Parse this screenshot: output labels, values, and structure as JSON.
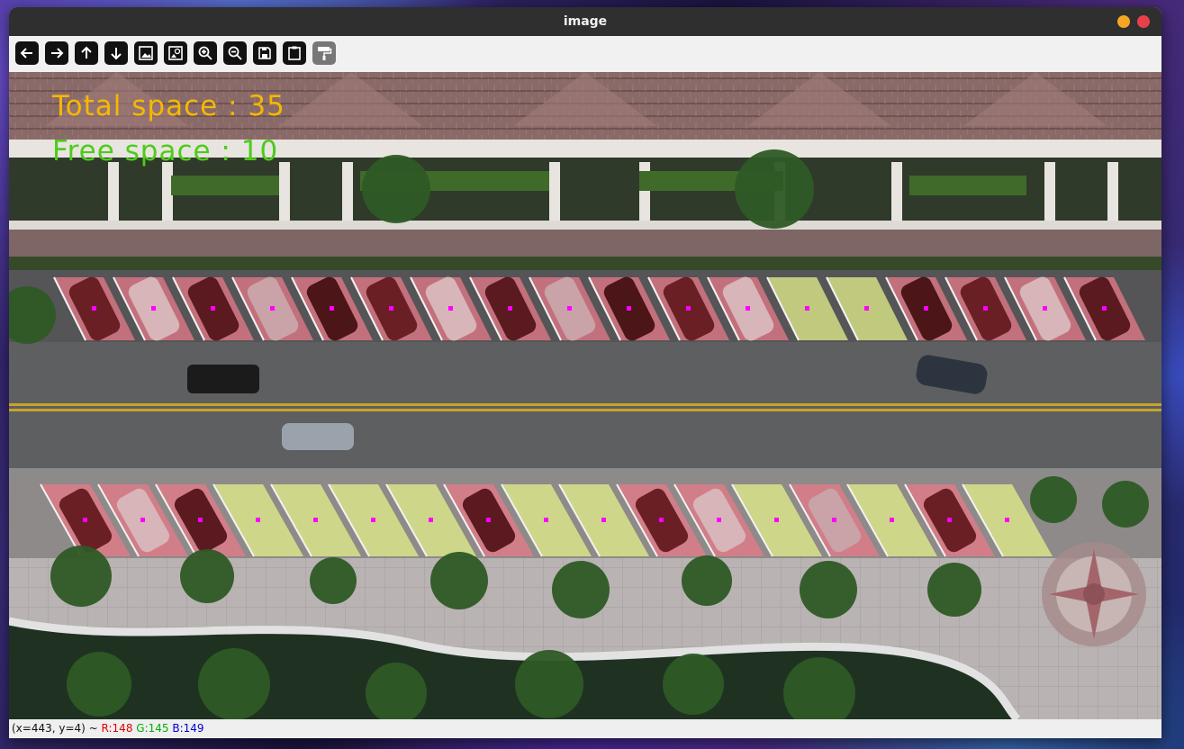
{
  "window": {
    "title": "image"
  },
  "toolbar": {
    "buttons": [
      {
        "name": "pan-left",
        "icon": "arrow-left-icon"
      },
      {
        "name": "pan-right",
        "icon": "arrow-right-icon"
      },
      {
        "name": "pan-up",
        "icon": "arrow-up-icon"
      },
      {
        "name": "pan-down",
        "icon": "arrow-down-icon"
      },
      {
        "name": "zoom-fit",
        "icon": "image-icon"
      },
      {
        "name": "zoom-original",
        "icon": "image-zoom-icon"
      },
      {
        "name": "zoom-in",
        "icon": "zoom-in-icon"
      },
      {
        "name": "zoom-out",
        "icon": "zoom-out-icon"
      },
      {
        "name": "save",
        "icon": "save-icon"
      },
      {
        "name": "copy-clipboard",
        "icon": "clipboard-icon"
      },
      {
        "name": "properties",
        "icon": "paint-roller-icon",
        "disabled": true
      }
    ]
  },
  "overlay": {
    "total_label": "Total space : 35",
    "free_label": "Free space : 10",
    "total_color": "#f5b800",
    "free_color": "#4ccc1a"
  },
  "parking": {
    "top_row_states": [
      "occ",
      "occ",
      "occ",
      "occ",
      "occ",
      "occ",
      "occ",
      "occ",
      "occ",
      "occ",
      "occ",
      "occ",
      "free",
      "free",
      "occ",
      "occ",
      "occ",
      "occ"
    ],
    "bottom_row_states": [
      "occ",
      "occ",
      "occ",
      "free",
      "free",
      "free",
      "free",
      "occ",
      "free",
      "free",
      "occ",
      "occ",
      "free",
      "occ",
      "free",
      "occ",
      "free"
    ],
    "occupied_color": "#e87a8a",
    "free_color": "#e4f08a",
    "marker_color": "#ff00ff"
  },
  "status_bar": {
    "coords": "(x=443, y=4) ~ ",
    "r": "R:148",
    "g": "G:145",
    "b": "B:149",
    "r_color": "#e00000",
    "g_color": "#00b000",
    "b_color": "#0000d0"
  }
}
